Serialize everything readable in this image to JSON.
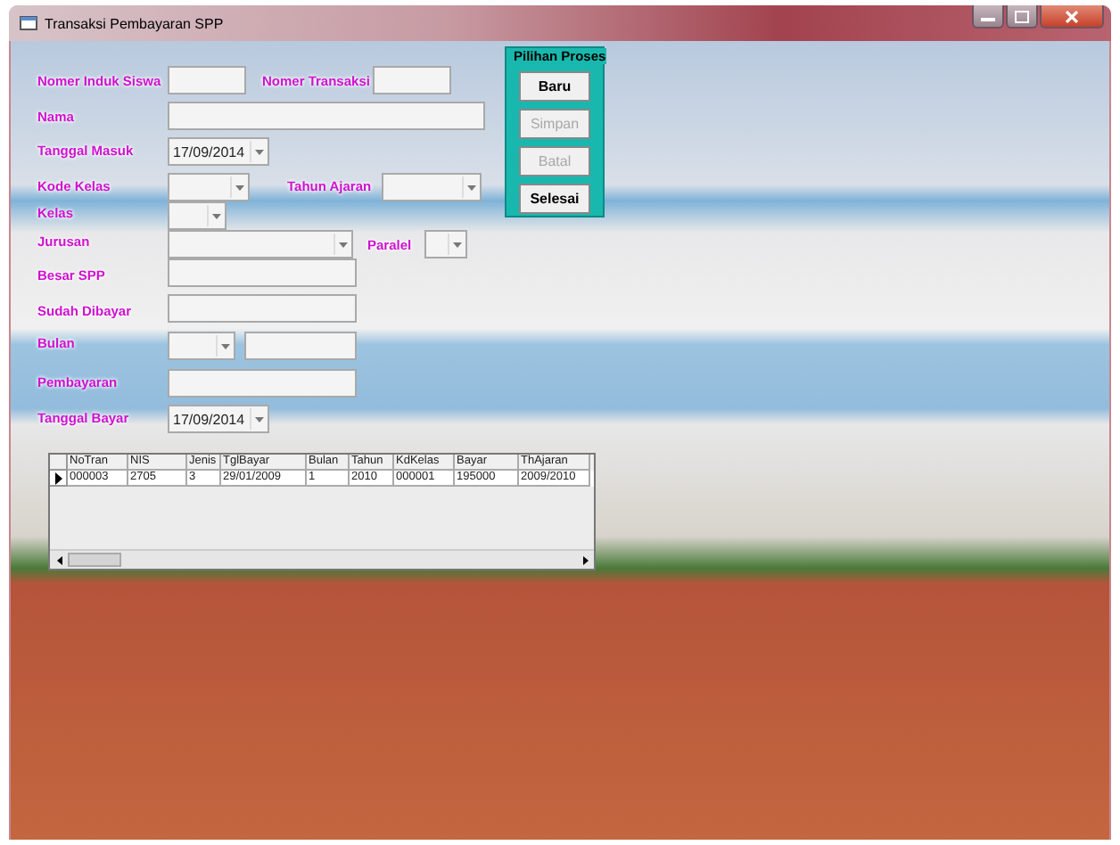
{
  "window": {
    "title": "Transaksi Pembayaran SPP"
  },
  "fields": [
    {
      "label": "Nomer Induk Siswa",
      "controls": [
        {
          "kind": "text"
        }
      ]
    },
    {
      "label": "Nomer Transaksi",
      "controls": [
        {
          "kind": "text"
        }
      ]
    },
    {
      "label": "Nama",
      "controls": [
        {
          "kind": "text"
        }
      ]
    },
    {
      "label": "Tanggal Masuk",
      "controls": [
        {
          "kind": "date",
          "value": "17/09/2014"
        }
      ]
    },
    {
      "label": "Kode Kelas",
      "controls": [
        {
          "kind": "combo"
        }
      ]
    },
    {
      "label": "Tahun Ajaran",
      "controls": [
        {
          "kind": "combo"
        }
      ]
    },
    {
      "label": "Kelas",
      "controls": [
        {
          "kind": "combo"
        }
      ]
    },
    {
      "label": "Jurusan",
      "controls": [
        {
          "kind": "combo"
        }
      ]
    },
    {
      "label": "Paralel",
      "controls": [
        {
          "kind": "combo"
        }
      ]
    },
    {
      "label": "Besar SPP",
      "controls": [
        {
          "kind": "text"
        }
      ]
    },
    {
      "label": "Sudah Dibayar",
      "controls": [
        {
          "kind": "text"
        }
      ]
    },
    {
      "label": "Bulan",
      "controls": [
        {
          "kind": "combo"
        },
        {
          "kind": "text"
        }
      ]
    },
    {
      "label": "Pembayaran",
      "controls": [
        {
          "kind": "text"
        }
      ]
    },
    {
      "label": "Tanggal Bayar",
      "controls": [
        {
          "kind": "date",
          "value": "17/09/2014"
        }
      ]
    }
  ],
  "process_group": {
    "title": "Pilihan Proses",
    "buttons": [
      {
        "label": "Baru",
        "disabled": false
      },
      {
        "label": "Simpan",
        "disabled": true
      },
      {
        "label": "Batal",
        "disabled": true
      },
      {
        "label": "Selesai",
        "disabled": false
      }
    ]
  },
  "table": {
    "columns": [
      "NoTran",
      "NIS",
      "Jenis",
      "TglBayar",
      "Bulan",
      "Tahun",
      "KdKelas",
      "Bayar",
      "ThAjaran"
    ],
    "rows": [
      {
        "selected": true,
        "cells": [
          "000003",
          "2705",
          "3",
          "29/01/2009",
          "1",
          "2010",
          "000001",
          "195000",
          "2009/2010"
        ]
      }
    ]
  }
}
